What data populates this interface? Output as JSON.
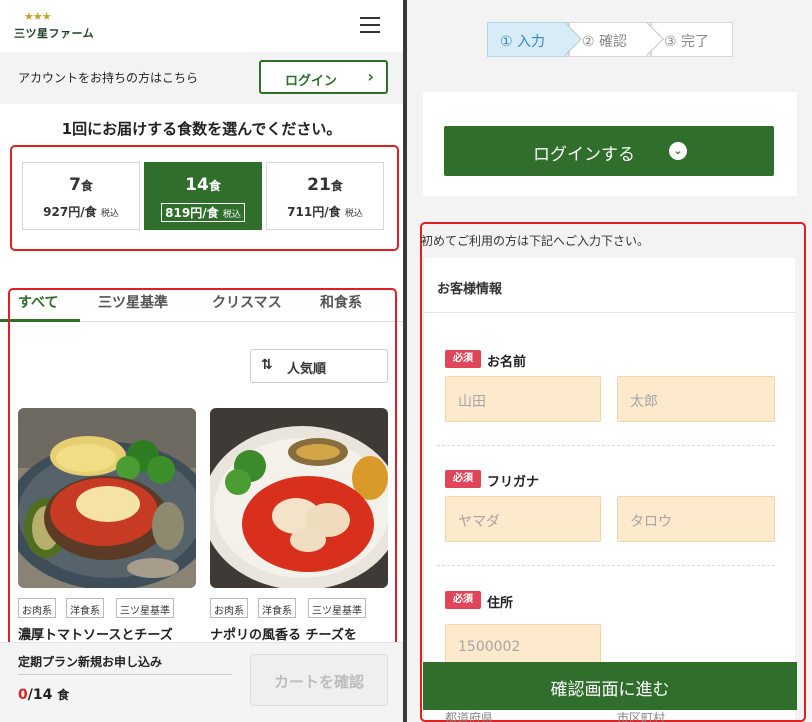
{
  "left": {
    "logo": {
      "stars": "★★★",
      "name": "三ツ星ファーム"
    },
    "account": {
      "prompt": "アカウントをお持ちの方はこちら",
      "login_label": "ログイン"
    },
    "quantity_title": "1回にお届けする食数を選んでください。",
    "plans": [
      {
        "count": "7",
        "unit": "食",
        "price": "927",
        "per": "円/食",
        "tax": "税込",
        "selected": false
      },
      {
        "count": "14",
        "unit": "食",
        "price": "819",
        "per": "円/食",
        "tax": "税込",
        "selected": true
      },
      {
        "count": "21",
        "unit": "食",
        "price": "711",
        "per": "円/食",
        "tax": "税込",
        "selected": false
      }
    ],
    "tabs": [
      "すべて",
      "三ツ星基準",
      "クリスマス",
      "和食系"
    ],
    "active_tab": "すべて",
    "sort_label": "人気順",
    "products": [
      {
        "tags": [
          "お肉系",
          "洋食系",
          "三ツ星基準"
        ],
        "name": "濃厚トマトソースとチーズ"
      },
      {
        "tags": [
          "お肉系",
          "洋食系",
          "三ツ星基準"
        ],
        "name": "ナポリの風香る チーズを"
      }
    ],
    "cart": {
      "title": "定期プラン新規お申し込み",
      "count": "0",
      "total": "/14",
      "unit": "食",
      "button": "カートを確認"
    }
  },
  "right": {
    "steps": [
      "① 入力",
      "② 確認",
      "③ 完了"
    ],
    "login_button": "ログインする",
    "first_time_note": "初めてご利用の方は下記へご入力下さい。",
    "section_title": "お客様情報",
    "required_label": "必須",
    "fields": [
      {
        "label": "お名前",
        "placeholders": [
          "山田",
          "太郎"
        ]
      },
      {
        "label": "フリガナ",
        "placeholders": [
          "ヤマダ",
          "タロウ"
        ]
      },
      {
        "label": "住所",
        "placeholders": [
          "1500002"
        ]
      }
    ],
    "confirm_button": "確認画面に進む",
    "peek": [
      "都道府県",
      "市区町村"
    ]
  },
  "colors": {
    "brand_green": "#2f6e2b",
    "required_red": "#e0455a",
    "input_bg": "#fde9cc",
    "step_active": "#2a8ac6"
  }
}
